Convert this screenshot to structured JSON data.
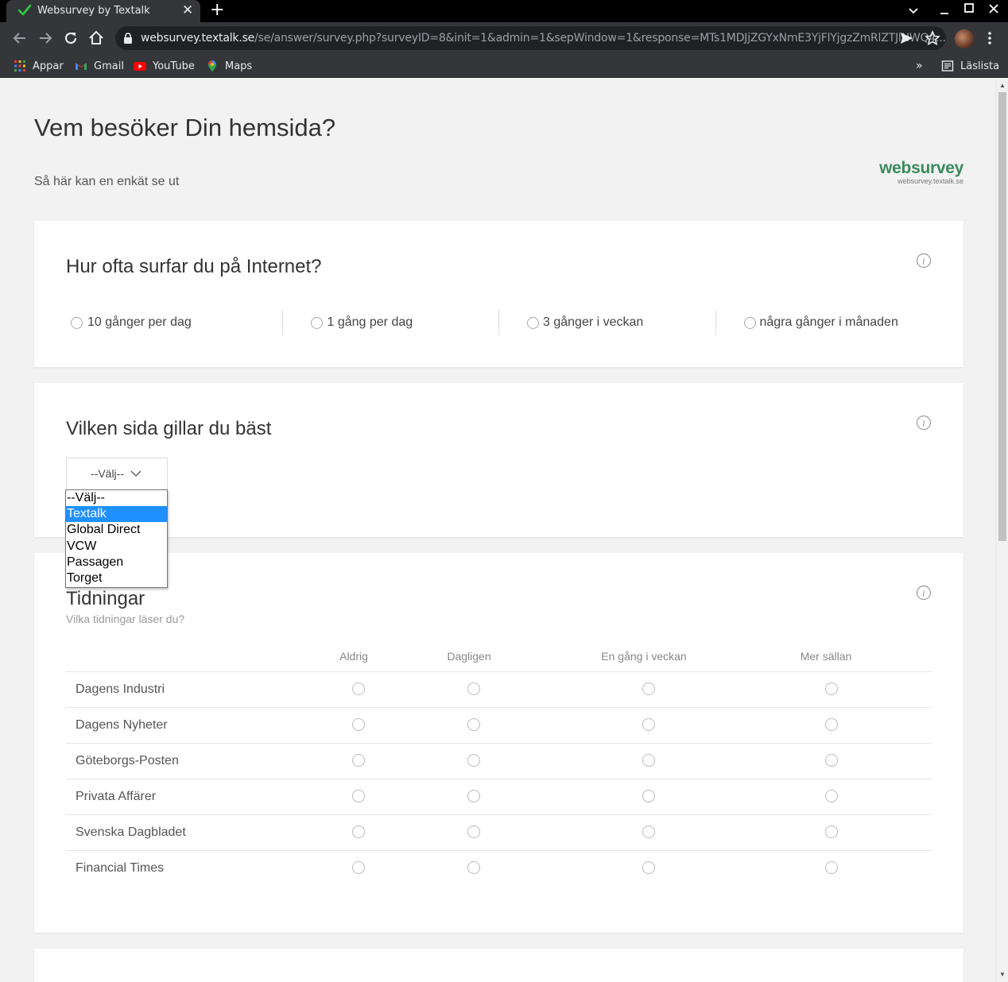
{
  "browser": {
    "tab_title": "Websurvey by Textalk",
    "url_host": "websurvey.textalk.se",
    "url_path": "/se/answer/survey.php?surveyID=8&init=1&admin=1&sepWindow=1&response=MTs1MDJjZGYxNmE3YjFlYjgzZmRlZTJlNWQ4...",
    "bookmarks": [
      "Appar",
      "Gmail",
      "YouTube",
      "Maps"
    ],
    "reading_list": "Läslista"
  },
  "page": {
    "title": "Vem besöker Din hemsida?",
    "subtitle": "Så här kan en enkät se ut",
    "logo_text": "websurvey",
    "logo_sub": "websurvey.textalk.se",
    "logo_color": "#3a8a5e"
  },
  "q1": {
    "title": "Hur ofta surfar du på Internet?",
    "options": [
      "10 gånger per dag",
      "1 gång per dag",
      "3 gånger i veckan",
      "några gånger i månaden"
    ]
  },
  "q2": {
    "title": "Vilken sida gillar du bäst",
    "selected": "--Välj--",
    "options": [
      "--Välj--",
      "Textalk",
      "Global Direct",
      "VCW",
      "Passagen",
      "Torget"
    ],
    "highlighted": "Textalk"
  },
  "q3": {
    "title": "Tidningar",
    "description": "Vilka tidningar läser du?",
    "columns": [
      "Aldrig",
      "Dagligen",
      "En gång i veckan",
      "Mer sällan"
    ],
    "rows": [
      "Dagens Industri",
      "Dagens Nyheter",
      "Göteborgs-Posten",
      "Privata Affärer",
      "Svenska Dagbladet",
      "Financial Times"
    ]
  }
}
